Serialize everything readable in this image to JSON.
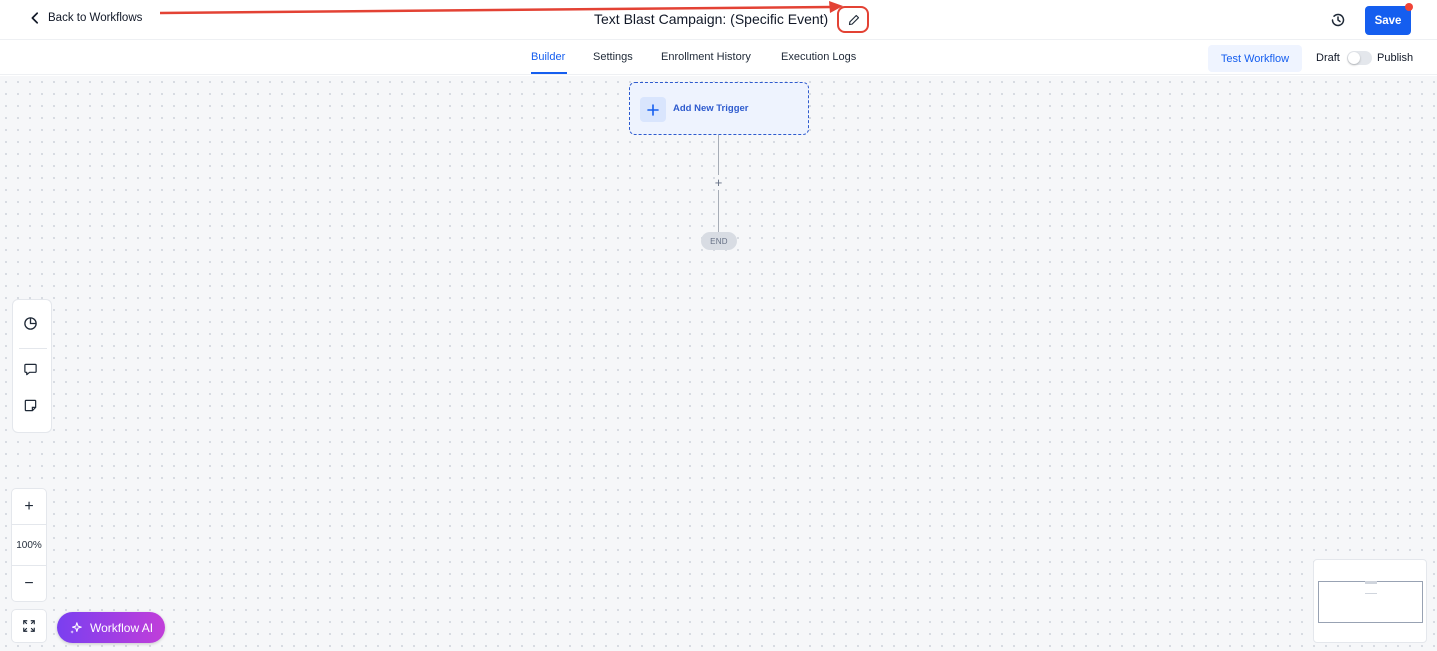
{
  "header": {
    "back_label": "Back to Workflows",
    "title": "Text Blast Campaign: (Specific Event)",
    "save_label": "Save"
  },
  "tabs": [
    {
      "label": "Builder",
      "active": true
    },
    {
      "label": "Settings",
      "active": false
    },
    {
      "label": "Enrollment History",
      "active": false
    },
    {
      "label": "Execution Logs",
      "active": false
    }
  ],
  "actions": {
    "test_workflow_label": "Test Workflow",
    "draft_label": "Draft",
    "publish_label": "Publish",
    "publish_toggle_on": false
  },
  "builder": {
    "trigger_label": "Add New Trigger",
    "add_step_symbol": "+",
    "end_label": "END"
  },
  "controls": {
    "zoom_in_symbol": "+",
    "zoom_level": "100%",
    "zoom_out_symbol": "−",
    "workflow_ai_label": "Workflow AI"
  },
  "colors": {
    "primary": "#155eef",
    "annotation": "#e34234",
    "ai_gradient_start": "#7a3ff0",
    "ai_gradient_end": "#c13ed9"
  },
  "icons": {
    "back": "chevron-left-icon",
    "edit": "pencil-icon",
    "history": "clock-history-icon",
    "tool_1": "pie-chart-icon",
    "tool_2": "comment-icon",
    "tool_3": "sticky-note-icon",
    "fit": "fit-view-icon",
    "ai": "sparkles-icon"
  }
}
